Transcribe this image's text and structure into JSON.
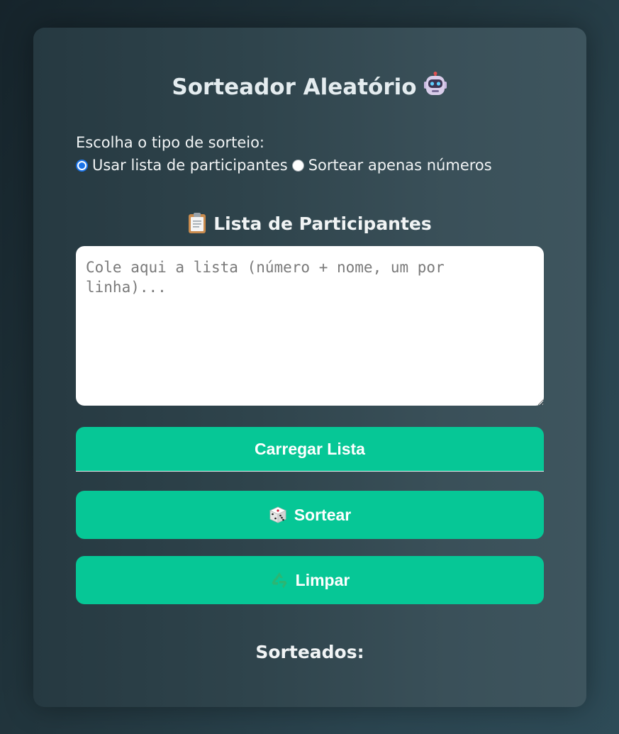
{
  "header": {
    "title": "Sorteador Aleatório",
    "title_icon": "robot-emoji"
  },
  "mode": {
    "prompt": "Escolha o tipo de sorteio:",
    "options": [
      {
        "label": "Usar lista de participantes",
        "checked": true
      },
      {
        "label": "Sortear apenas números",
        "checked": false
      }
    ]
  },
  "participants": {
    "section_title": "Lista de Participantes",
    "section_icon": "clipboard-emoji",
    "placeholder": "Cole aqui a lista (número + nome, um por linha)...",
    "value": ""
  },
  "buttons": {
    "load_label": "Carregar Lista",
    "draw_label": "Sortear",
    "draw_icon": "dice-emoji",
    "clear_label": "Limpar",
    "clear_icon": "recycle-emoji"
  },
  "results": {
    "title": "Sorteados:"
  },
  "colors": {
    "accent": "#06c796",
    "radio_checked": "#1a73e8",
    "card_bg": "#2f444c"
  }
}
